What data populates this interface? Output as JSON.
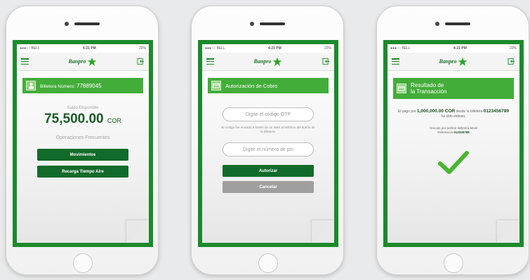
{
  "status_bar": {
    "carrier": "●●●○○ BELL",
    "time": "4:21 PM",
    "battery": "22%"
  },
  "brand": {
    "logo_text": "Banpro",
    "primary_color": "#1b8a2c",
    "accent_color": "#43ad3a",
    "dark_button_color": "#116b2a"
  },
  "screen1": {
    "banner_prefix": "Billetera Número:",
    "wallet_number": "77889045",
    "balance_label": "Saldo Disponible",
    "balance_amount": "75,500.00",
    "balance_currency": "COR",
    "frequent_label": "Operaciones Frecuentes",
    "btn_movements": "Movimientos",
    "btn_topup": "Recarga Tiempo Aire"
  },
  "screen2": {
    "banner_title": "Autorización de Cobro",
    "otp_placeholder": "Digite el código OTP",
    "otp_note": "El código fue enviado a través de un SMS al teléfono del dueño de la billetera.",
    "pin_placeholder": "Digite el número de pin",
    "btn_authorize": "Autorizar",
    "btn_cancel": "Cancelar"
  },
  "screen3": {
    "banner_title_line1": "Resultado de",
    "banner_title_line2": "la Transacción",
    "text_prefix": "El pago por",
    "amount": "1,000,000.00 COR",
    "text_middle": "desde la billetera",
    "wallet": "0123456789",
    "text_suffix": "ha sido exitoso.",
    "thanks_line": "Gracias por preferir Billetera Movil",
    "reference_label": "Referencia",
    "reference": "012345789",
    "success_icon": "checkmark-icon"
  }
}
